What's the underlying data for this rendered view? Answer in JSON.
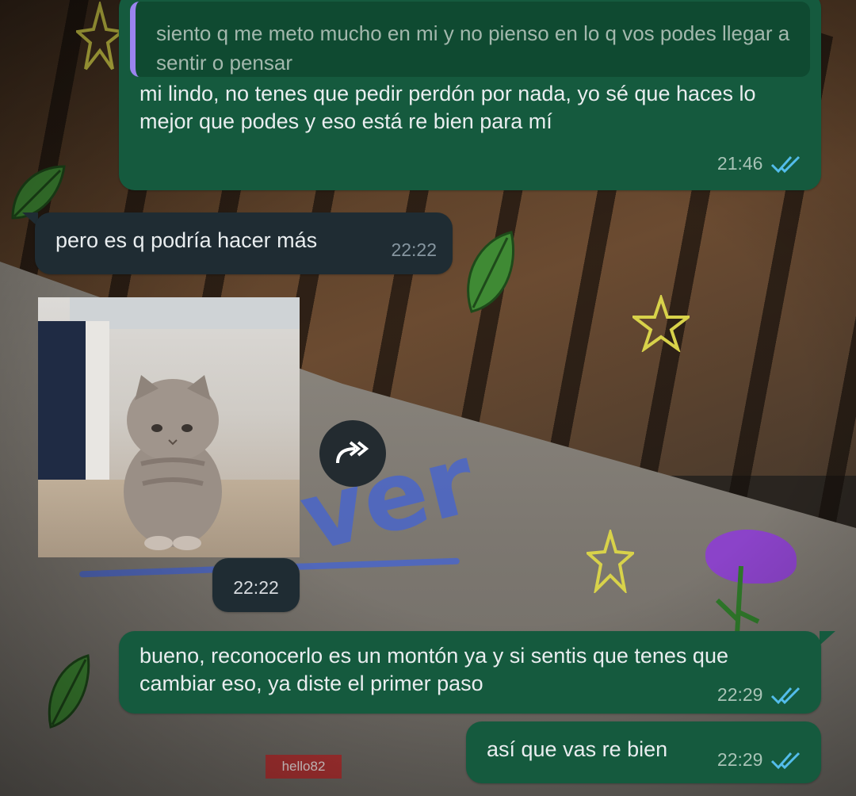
{
  "colors": {
    "outgoing_bubble": "#155a3e",
    "incoming_bubble": "#1f2c33",
    "quote_bar": "#9b84ef",
    "read_ticks": "#53bdeb"
  },
  "messages": [
    {
      "direction": "outgoing",
      "quoted": {
        "author": "",
        "text": "siento q me meto mucho en mi y no pienso en lo q vos podes llegar a sentir o pensar"
      },
      "text": "mi lindo, no tenes que pedir perdón por nada, yo sé que haces lo mejor que podes y eso está re bien para mí",
      "time": "21:46",
      "status": "read"
    },
    {
      "direction": "incoming",
      "text": "pero es q podría hacer más",
      "time": "22:22"
    },
    {
      "direction": "incoming",
      "type": "image",
      "image_description": "sad kitten sticker",
      "time": "22:22"
    },
    {
      "direction": "outgoing",
      "text": "bueno, reconocerlo es un montón ya y si sentis que tenes que cambiar eso, ya diste el primer paso",
      "time": "22:29",
      "status": "read"
    },
    {
      "direction": "outgoing",
      "text": "así que vas re bien",
      "time": "22:29",
      "status": "read"
    }
  ],
  "wallpaper": {
    "doodle_text": "ver",
    "sign_text": "hello82"
  },
  "icons": {
    "forward": "forward-icon",
    "read_ticks": "double-check-icon"
  }
}
